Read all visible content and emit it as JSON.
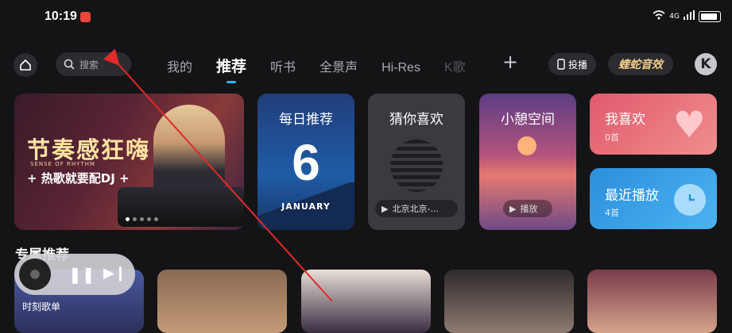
{
  "status_bar": {
    "time": "10:19",
    "network": "4G"
  },
  "search": {
    "placeholder": "搜索"
  },
  "tabs": [
    {
      "label": "我的"
    },
    {
      "label": "推荐"
    },
    {
      "label": "听书"
    },
    {
      "label": "全景声"
    },
    {
      "label": "Hi-Res"
    },
    {
      "label": "K歌"
    }
  ],
  "header": {
    "plus": "+",
    "cast_label": "投播",
    "effect_label": "蝰蛇音效",
    "k_label": "K"
  },
  "banner": {
    "title": "节奏感狂嗨",
    "subtitle_en": "SENSE OF RHYTHM",
    "subtitle": "+ 热歌就要配DJ +"
  },
  "daily": {
    "title": "每日推荐",
    "day": "6",
    "month": "JANUARY"
  },
  "guess": {
    "title": "猜你喜欢",
    "now_playing": "北京北京-..."
  },
  "relax": {
    "title": "小憩空间",
    "play_label": "播放"
  },
  "like": {
    "title": "我喜欢",
    "count": "0首"
  },
  "recent": {
    "title": "最近播放",
    "count": "4首"
  },
  "section": {
    "title": "专属推荐"
  },
  "cards": [
    {
      "label": "时刻歌单"
    }
  ],
  "colors": {
    "accent": "#2fb6e8",
    "like_card": "#e05a6c",
    "recent_card": "#2b8fdc",
    "annotation_arrow": "#e02a2a"
  }
}
